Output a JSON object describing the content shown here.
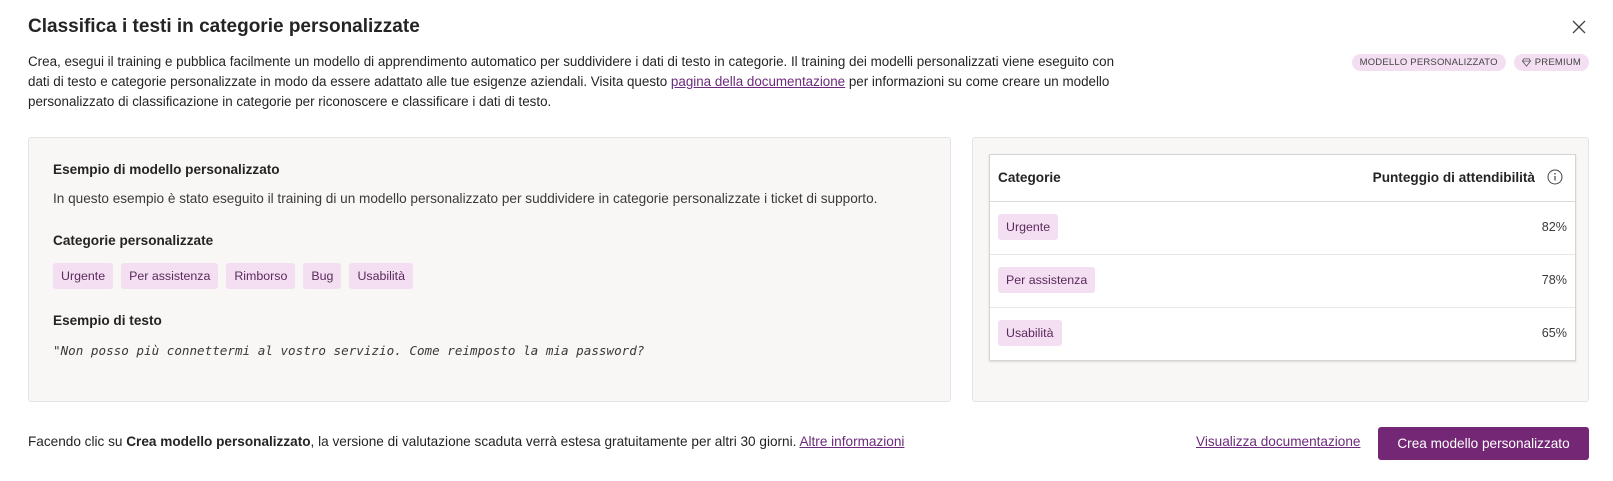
{
  "dialog": {
    "title": "Classifica i testi in categorie personalizzate",
    "description_1": "Crea, esegui il training e pubblica facilmente un modello di apprendimento automatico per suddividere i dati di testo in categorie. Il training dei modelli personalizzati viene eseguito con dati di testo e categorie personalizzate in modo da essere adattato alle tue esigenze aziendali. Visita questo ",
    "description_link": "pagina della documentazione",
    "description_2": " per informazioni su come creare un modello personalizzato di classificazione in categorie per riconoscere e classificare i dati di testo.",
    "badges": {
      "custom_model": "MODELLO PERSONALIZZATO",
      "premium": "PREMIUM"
    }
  },
  "example": {
    "title": "Esempio di modello personalizzato",
    "description": "In questo esempio è stato eseguito il training di un modello personalizzato per suddividere in categorie personalizzate i ticket di supporto.",
    "categories_title": "Categorie personalizzate",
    "categories": [
      "Urgente",
      "Per assistenza",
      "Rimborso",
      "Bug",
      "Usabilità"
    ],
    "sample_title": "Esempio di testo",
    "sample_text": "\"Non posso più connettermi al vostro servizio. Come reimposto la mia password?"
  },
  "results": {
    "col_category": "Categorie",
    "col_score": "Punteggio di attendibilità",
    "rows": [
      {
        "category": "Urgente",
        "score": "82%"
      },
      {
        "category": "Per assistenza",
        "score": "78%"
      },
      {
        "category": "Usabilità",
        "score": "65%"
      }
    ]
  },
  "footer": {
    "text_1": "Facendo clic su ",
    "text_bold": "Crea modello personalizzato",
    "text_2": ", la versione di valutazione scaduta verrà estesa gratuitamente per altri 30 giorni. ",
    "more_info_link": "Altre informazioni",
    "doc_link": "Visualizza documentazione",
    "primary_button": "Crea modello personalizzato"
  },
  "colors": {
    "accent": "#742774",
    "link": "#6b2a7b",
    "tag_bg": "#f4dff2"
  },
  "icons": {
    "close": "close-icon",
    "premium": "diamond-icon",
    "info": "info-icon"
  }
}
